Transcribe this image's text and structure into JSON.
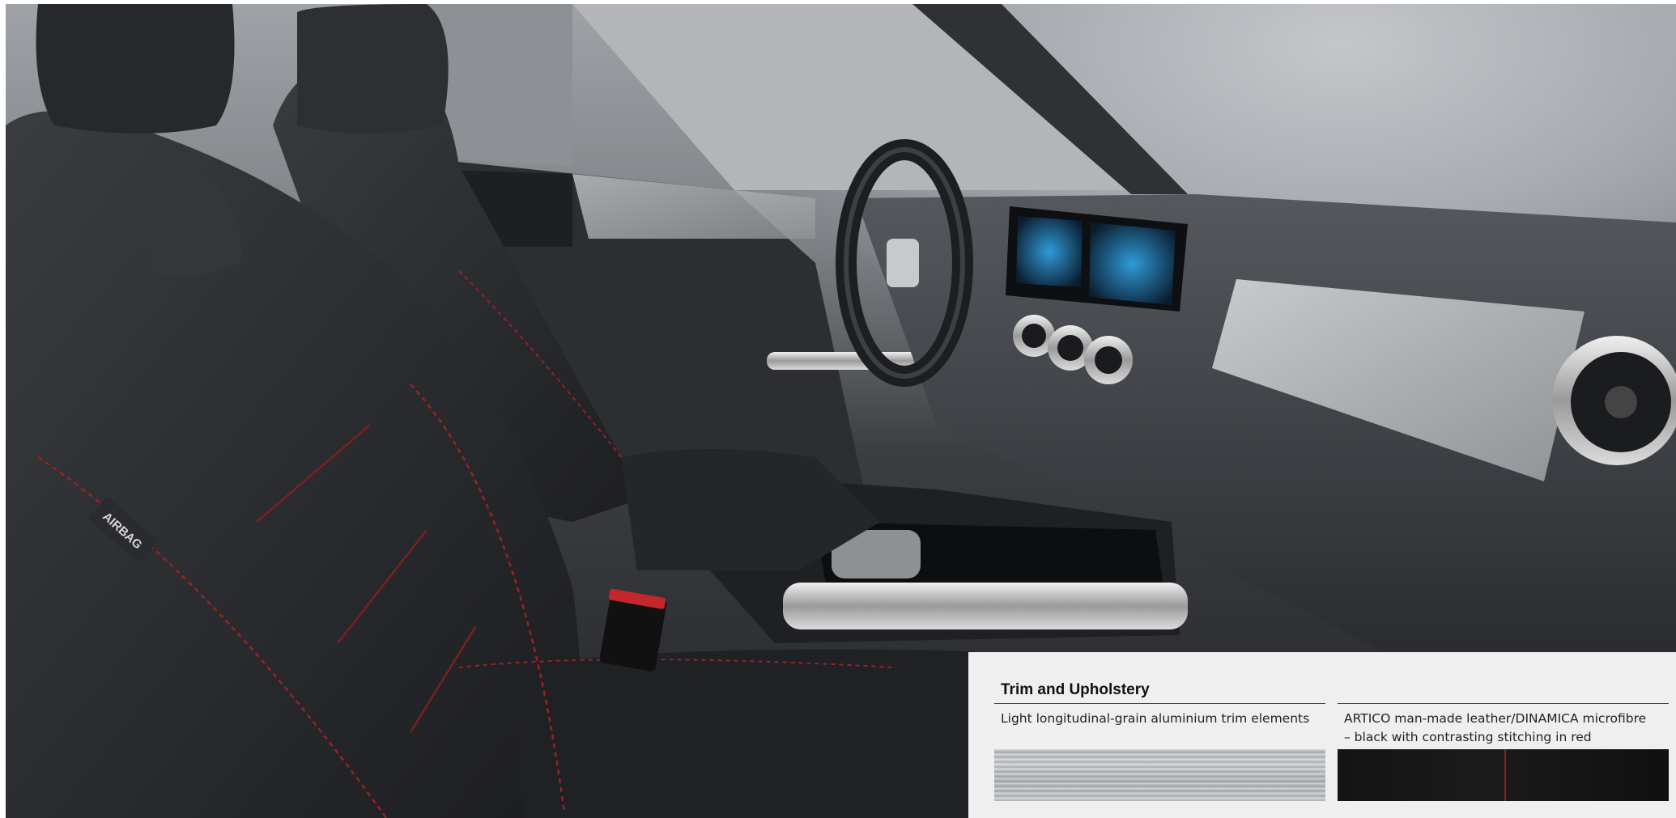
{
  "photo": {
    "airbag_tag": "AIRBAG",
    "stitch_color": "#9a2222"
  },
  "panel": {
    "title": "Trim and Upholstery",
    "trim": {
      "label": "Light longitudinal-grain aluminium trim elements"
    },
    "upholstery": {
      "label_line1": "ARTICO man-made leather/DINAMICA microfibre",
      "label_line2": "– black with contrasting stitching in red"
    }
  }
}
